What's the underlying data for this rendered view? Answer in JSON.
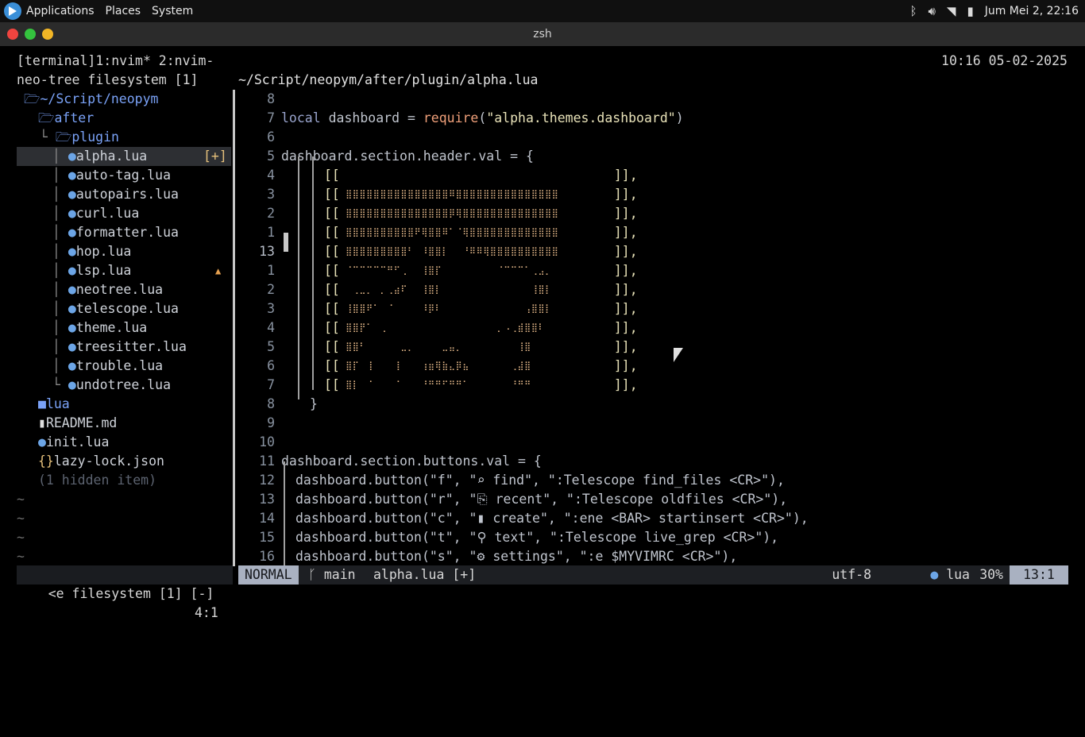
{
  "panel": {
    "menus": [
      "Applications",
      "Places",
      "System"
    ],
    "clock": "Jum Mei  2, 22:16"
  },
  "window": {
    "title": "zsh"
  },
  "tmux": {
    "status": "[terminal]1:nvim* 2:nvim-",
    "clock": "10:16 05-02-2025"
  },
  "tree": {
    "title": "neo-tree filesystem [1]",
    "root": "~/Script/neopym",
    "items": {
      "after": "after",
      "plugin": "plugin",
      "files": [
        "alpha.lua",
        "auto-tag.lua",
        "autopairs.lua",
        "curl.lua",
        "formatter.lua",
        "hop.lua",
        "lsp.lua",
        "neotree.lua",
        "telescope.lua",
        "theme.lua",
        "treesitter.lua",
        "trouble.lua",
        "undotree.lua"
      ],
      "lua": "lua",
      "readme": "README.md",
      "init": "init.lua",
      "lazy": "lazy-lock.json",
      "hidden": "(1 hidden item)"
    },
    "modified_mark": "[+]",
    "warning_mark": "▲"
  },
  "editor": {
    "path": "~/Script/neopym/after/plugin/alpha.lua",
    "line_numbers": [
      "8",
      "7",
      "6",
      "5",
      "4",
      "3",
      "2",
      "1",
      "13",
      "1",
      "2",
      "3",
      "4",
      "5",
      "6",
      "7",
      "8",
      "9",
      "10",
      "11",
      "12",
      "13",
      "14",
      "15",
      "16"
    ],
    "code": {
      "l7": "local dashboard = require(\"alpha.themes.dashboard\")",
      "l5": "dashboard.section.header.val = {",
      "close": "}",
      "l11": "dashboard.section.buttons.val = {",
      "b1": "dashboard.button(\"f\", \"⌕ find\", \":Telescope find_files <CR>\"),",
      "b2": "dashboard.button(\"r\", \"⎘ recent\", \":Telescope oldfiles <CR>\"),",
      "b3": "dashboard.button(\"c\", \"▮ create\", \":ene <BAR> startinsert <CR>\"),",
      "b4": "dashboard.button(\"t\", \"⚲ text\", \":Telescope live_grep <CR>\"),",
      "b5": "dashboard.button(\"s\", \"⚙ settings\", \":e $MYVIMRC <CR>\"),"
    },
    "header_open": "[[",
    "header_close": "]],"
  },
  "status_left": {
    "name": "<e filesystem [1] [-]",
    "pos": "4:1"
  },
  "status_main": {
    "mode": "NORMAL",
    "branch": "main",
    "file": "alpha.lua [+]",
    "encoding": "utf-8",
    "filetype": "lua",
    "percent": "30%",
    "linecol": "13:1"
  }
}
